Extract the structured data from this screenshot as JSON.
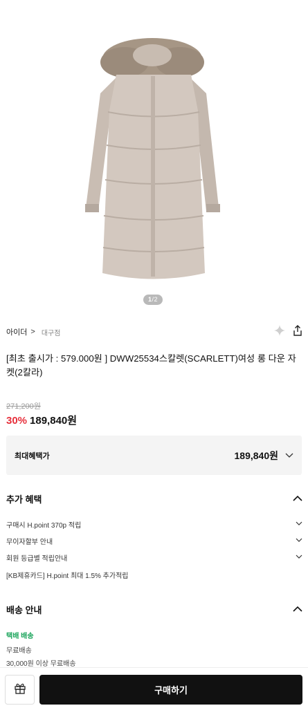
{
  "gallery": {
    "current": "1",
    "separator": "/",
    "total": "2"
  },
  "brand": {
    "name": "아이더",
    "chevron": ">",
    "store": "대구점",
    "icons": [
      "diamond-icon",
      "share-icon"
    ]
  },
  "product": {
    "title": "[최초 출시가 : 579.000원 ] DWW25534스칼렛(SCARLETT)여성 롱 다운 자켓(2칼라)",
    "original_price": "271,200원",
    "discount_rate": "30%",
    "price": "189,840원"
  },
  "max_benefit": {
    "label": "최대혜택가",
    "value": "189,840원"
  },
  "extra_benefits": {
    "heading": "추가 혜택",
    "items": [
      {
        "label": "구매시 H.point 370p 적립"
      },
      {
        "label": "무이자할부 안내"
      },
      {
        "label": "회원 등급별 적립안내"
      },
      {
        "label": "[KB제휴카드] H.point 최대 1.5% 추가적립"
      }
    ]
  },
  "shipping": {
    "heading": "배송 안내",
    "method": "택배 배송",
    "fee": "무료배송",
    "condition": "30,000원 이상 무료배송"
  },
  "bottom_bar": {
    "buy_label": "구매하기"
  },
  "colors": {
    "discount": "#e7303c",
    "ship_green": "#1ba45b",
    "buy_bg": "#111111",
    "box_bg": "#f4f4f4"
  }
}
